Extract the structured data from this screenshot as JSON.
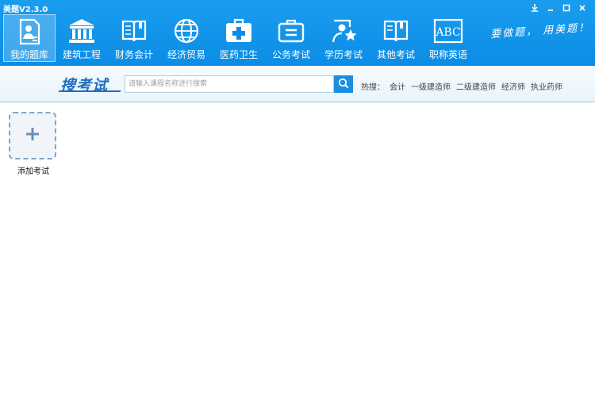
{
  "window": {
    "title": "美题V2.3.0",
    "controls": [
      "download-icon",
      "minimize-icon",
      "maximize-icon",
      "close-icon"
    ]
  },
  "nav": {
    "items": [
      {
        "label": "我的题库",
        "icon": "my-question-bank-icon",
        "active": true
      },
      {
        "label": "建筑工程",
        "icon": "building-pillars-icon",
        "active": false
      },
      {
        "label": "财务会计",
        "icon": "open-book-icon",
        "active": false
      },
      {
        "label": "经济贸易",
        "icon": "globe-icon",
        "active": false
      },
      {
        "label": "医药卫生",
        "icon": "medical-kit-icon",
        "active": false
      },
      {
        "label": "公务考试",
        "icon": "briefcase-icon",
        "active": false
      },
      {
        "label": "学历考试",
        "icon": "graduate-star-icon",
        "active": false
      },
      {
        "label": "其他考试",
        "icon": "book-icon",
        "active": false
      },
      {
        "label": "职称英语",
        "icon": "abc-icon",
        "active": false
      }
    ],
    "slogan": "要做题， 用美题！"
  },
  "search": {
    "logo": "搜考试",
    "placeholder": "请输入课程名称进行搜索",
    "hot_label": "热搜：",
    "hot_items": [
      "会计",
      "一级建造师",
      "二级建造师",
      "经济师",
      "执业药师"
    ]
  },
  "content": {
    "add_exam_label": "添加考试"
  },
  "colors": {
    "primary": "#0b8de6",
    "accent": "#1f6fbf",
    "card_border": "#7ea6cc"
  }
}
